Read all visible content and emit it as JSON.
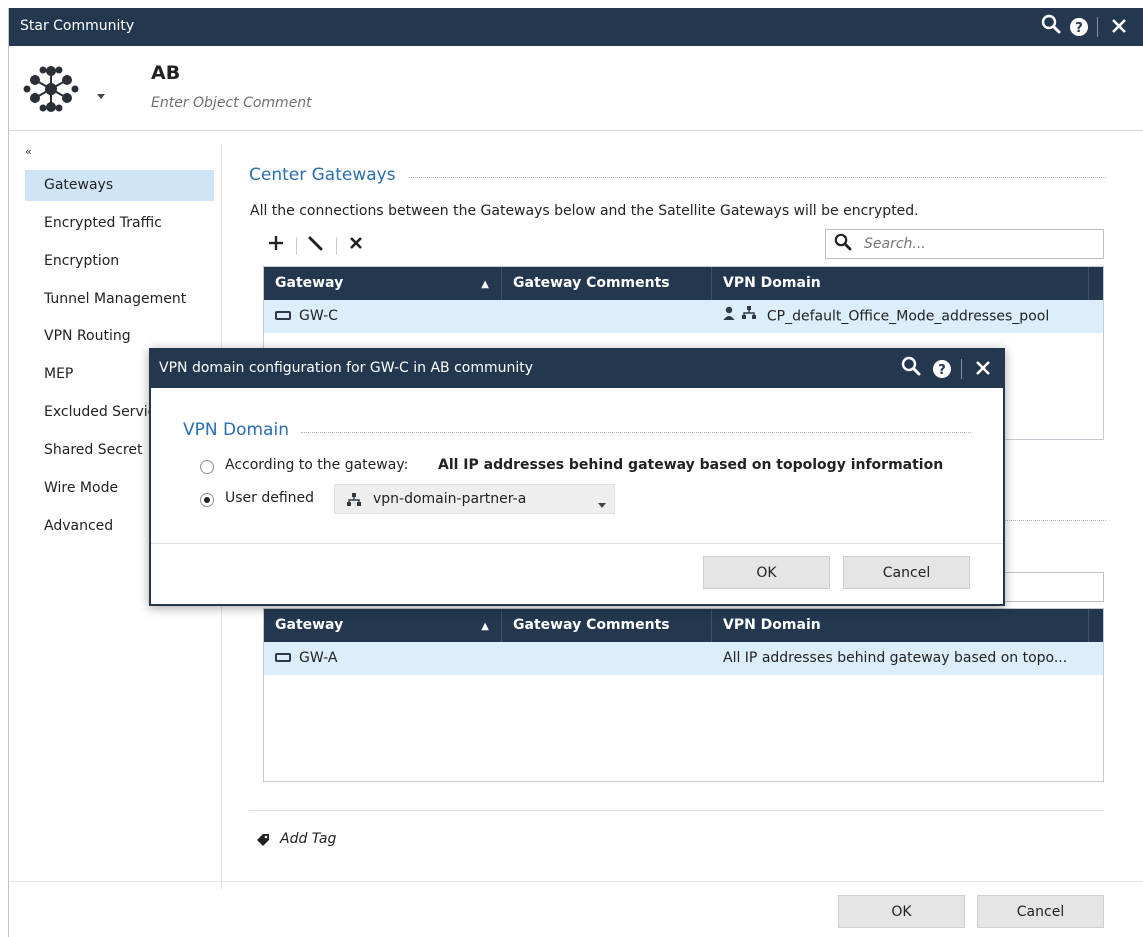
{
  "window": {
    "title": "Star Community",
    "object_name": "AB",
    "object_comment": "Enter Object Comment"
  },
  "sidebar": {
    "collapse_glyph": "«",
    "items": [
      {
        "label": "Gateways",
        "active": true
      },
      {
        "label": "Encrypted Traffic"
      },
      {
        "label": "Encryption"
      },
      {
        "label": "Tunnel Management"
      },
      {
        "label": "VPN Routing"
      },
      {
        "label": "MEP"
      },
      {
        "label": "Excluded Services"
      },
      {
        "label": "Shared Secret"
      },
      {
        "label": "Wire Mode"
      },
      {
        "label": "Advanced"
      }
    ]
  },
  "center_gateways": {
    "title": "Center Gateways",
    "description": "All the connections between the Gateways below and the Satellite Gateways will be encrypted.",
    "search_placeholder": "Search...",
    "columns": [
      "Gateway",
      "Gateway Comments",
      "VPN Domain"
    ],
    "rows": [
      {
        "gateway": "GW-C",
        "comments": "",
        "vpn_domain": "CP_default_Office_Mode_addresses_pool"
      }
    ]
  },
  "satellite_gateways": {
    "columns": [
      "Gateway",
      "Gateway Comments",
      "VPN Domain"
    ],
    "rows": [
      {
        "gateway": "GW-A",
        "comments": "",
        "vpn_domain": "All IP addresses behind gateway based on topo..."
      }
    ]
  },
  "add_tag_label": "Add Tag",
  "footer": {
    "ok_label": "OK",
    "cancel_label": "Cancel"
  },
  "dialog": {
    "title": "VPN domain configuration for GW-C in AB community",
    "section_title": "VPN Domain",
    "option_gateway_label": "According to the gateway:",
    "option_gateway_value": "All IP addresses behind gateway based on topology information",
    "option_user_label": "User defined",
    "user_defined_value": "vpn-domain-partner-a",
    "ok_label": "OK",
    "cancel_label": "Cancel"
  },
  "colors": {
    "accent": "#2a6db3",
    "titlebar": "#23384f",
    "selection": "#dceefb"
  }
}
